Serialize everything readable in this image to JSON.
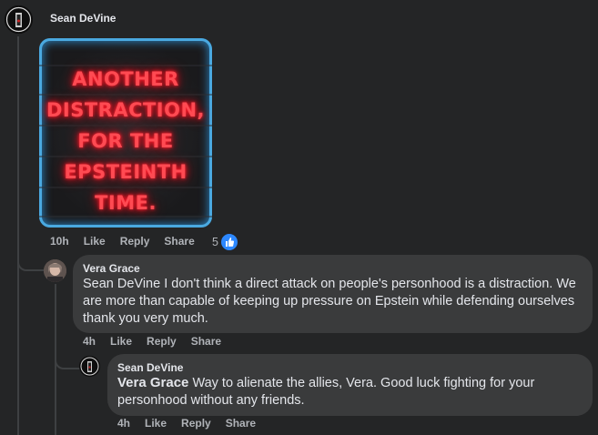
{
  "top_comment": {
    "author": "Sean DeVine",
    "image_text_lines": [
      "ANOTHER",
      "DISTRACTION,",
      "FOR THE",
      "EPSTEINTH",
      "TIME."
    ],
    "time": "10h",
    "like_label": "Like",
    "reply_label": "Reply",
    "share_label": "Share",
    "reaction_count": "5"
  },
  "reply1": {
    "author": "Vera Grace",
    "text": "Sean DeVine I don't think a direct attack on people's personhood is a distraction. We are more than capable of keeping up pressure on Epstein while defending ourselves thank you very much.",
    "time": "4h",
    "like_label": "Like",
    "reply_label": "Reply",
    "share_label": "Share"
  },
  "reply2": {
    "author": "Sean DeVine",
    "mention": "Vera Grace",
    "text": "Way to alienate the allies, Vera. Good luck fighting for your personhood without any friends.",
    "time": "4h",
    "like_label": "Like",
    "reply_label": "Reply",
    "share_label": "Share"
  },
  "colors": {
    "background": "#242526",
    "bubble": "#3a3b3c",
    "secondary_text": "#b0b3b8",
    "like_blue": "#2d88ff"
  }
}
